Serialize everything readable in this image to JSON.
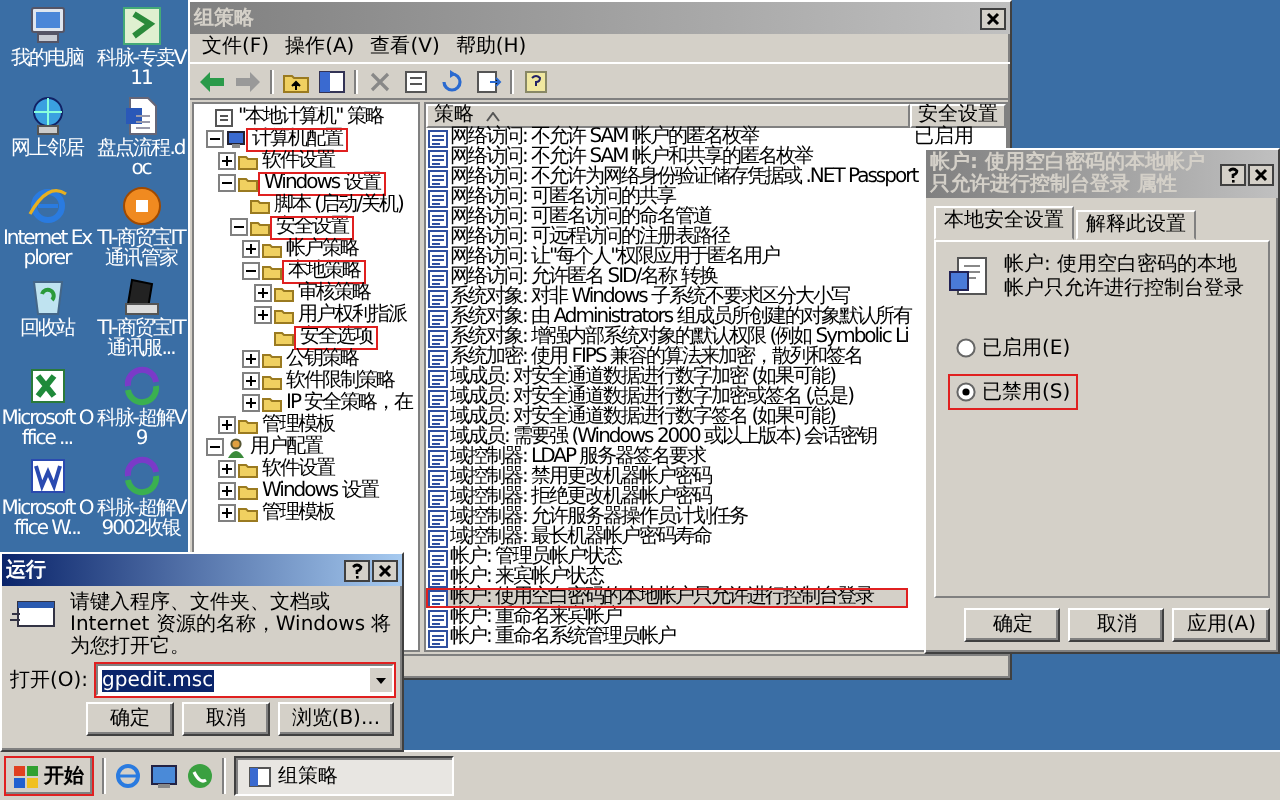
{
  "desktop_icons": [
    {
      "label": "我的电脑"
    },
    {
      "label": "科脉-专卖V11"
    },
    {
      "label": "网上邻居"
    },
    {
      "label": "盘点流程.doc"
    },
    {
      "label": "Internet Explorer"
    },
    {
      "label": "TI-商贸宝IT通讯管家"
    },
    {
      "label": "回收站"
    },
    {
      "label": "TI-商贸宝IT通讯服..."
    },
    {
      "label": "Microsoft Office ..."
    },
    {
      "label": "科脉-超解V9"
    },
    {
      "label": "Microsoft Office W..."
    },
    {
      "label": "科脉-超解V9002收银"
    }
  ],
  "policy_window": {
    "title": "组策略",
    "active": false,
    "menu": [
      "文件(F)",
      "操作(A)",
      "查看(V)",
      "帮助(H)"
    ],
    "tree": [
      {
        "label": "\"本地计算机\" 策略",
        "kind": "none",
        "highlighted": false,
        "children": [
          {
            "label": "计算机配置",
            "kind": "expanded",
            "highlighted": true,
            "children": [
              {
                "label": "软件设置",
                "kind": "collapsed",
                "highlighted": false
              },
              {
                "label": "Windows 设置",
                "kind": "expanded",
                "highlighted": true,
                "children": [
                  {
                    "label": "脚本 (启动/关机)",
                    "kind": "none",
                    "highlighted": false
                  },
                  {
                    "label": "安全设置",
                    "kind": "expanded",
                    "highlighted": true,
                    "children": [
                      {
                        "label": "帐户策略",
                        "kind": "collapsed",
                        "highlighted": false
                      },
                      {
                        "label": "本地策略",
                        "kind": "expanded",
                        "highlighted": true,
                        "children": [
                          {
                            "label": "审核策略",
                            "kind": "collapsed",
                            "highlighted": false
                          },
                          {
                            "label": "用户权利指派",
                            "kind": "collapsed",
                            "highlighted": false
                          },
                          {
                            "label": "安全选项",
                            "kind": "none",
                            "highlighted": true
                          }
                        ]
                      },
                      {
                        "label": "公钥策略",
                        "kind": "collapsed",
                        "highlighted": false
                      },
                      {
                        "label": "软件限制策略",
                        "kind": "collapsed",
                        "highlighted": false
                      },
                      {
                        "label": "IP 安全策略，在",
                        "kind": "collapsed",
                        "highlighted": false
                      }
                    ]
                  }
                ]
              },
              {
                "label": "管理模板",
                "kind": "collapsed",
                "highlighted": false
              }
            ]
          },
          {
            "label": "用户配置",
            "kind": "expanded",
            "highlighted": false,
            "children": [
              {
                "label": "软件设置",
                "kind": "collapsed",
                "highlighted": false
              },
              {
                "label": "Windows 设置",
                "kind": "collapsed",
                "highlighted": false
              },
              {
                "label": "管理模板",
                "kind": "collapsed",
                "highlighted": false
              }
            ]
          }
        ]
      }
    ],
    "list": {
      "columns": [
        "策略",
        "安全设置"
      ],
      "rows": [
        {
          "policy": "网络访问: 不允许 SAM 帐户的匿名枚举",
          "setting": "已启用",
          "selected": false,
          "highlighted": false
        },
        {
          "policy": "网络访问: 不允许 SAM 帐户和共享的匿名枚举",
          "selected": false,
          "highlighted": false
        },
        {
          "policy": "网络访问: 不允许为网络身份验证储存凭据或 .NET Passport",
          "selected": false,
          "highlighted": false
        },
        {
          "policy": "网络访问: 可匿名访问的共享",
          "selected": false,
          "highlighted": false
        },
        {
          "policy": "网络访问: 可匿名访问的命名管道",
          "selected": false,
          "highlighted": false
        },
        {
          "policy": "网络访问: 可远程访问的注册表路径",
          "selected": false,
          "highlighted": false
        },
        {
          "policy": "网络访问: 让\"每个人\"权限应用于匿名用户",
          "selected": false,
          "highlighted": false
        },
        {
          "policy": "网络访问: 允许匿名 SID/名称 转换",
          "selected": false,
          "highlighted": false
        },
        {
          "policy": "系统对象: 对非 Windows 子系统不要求区分大小写",
          "selected": false,
          "highlighted": false
        },
        {
          "policy": "系统对象: 由 Administrators 组成员所创建的对象默认所有",
          "selected": false,
          "highlighted": false
        },
        {
          "policy": "系统对象: 增强内部系统对象的默认权限 (例如 Symbolic Li",
          "selected": false,
          "highlighted": false
        },
        {
          "policy": "系统加密: 使用 FIPS 兼容的算法来加密，散列和签名",
          "selected": false,
          "highlighted": false
        },
        {
          "policy": "域成员: 对安全通道数据进行数字加密 (如果可能)",
          "selected": false,
          "highlighted": false
        },
        {
          "policy": "域成员: 对安全通道数据进行数字加密或签名 (总是)",
          "selected": false,
          "highlighted": false
        },
        {
          "policy": "域成员: 对安全通道数据进行数字签名 (如果可能)",
          "selected": false,
          "highlighted": false
        },
        {
          "policy": "域成员: 需要强 (Windows 2000 或以上版本) 会话密钥",
          "selected": false,
          "highlighted": false
        },
        {
          "policy": "域控制器: LDAP 服务器签名要求",
          "selected": false,
          "highlighted": false
        },
        {
          "policy": "域控制器: 禁用更改机器帐户密码",
          "selected": false,
          "highlighted": false
        },
        {
          "policy": "域控制器: 拒绝更改机器帐户密码",
          "selected": false,
          "highlighted": false
        },
        {
          "policy": "域控制器: 允许服务器操作员计划任务",
          "selected": false,
          "highlighted": false
        },
        {
          "policy": "域控制器: 最长机器帐户密码寿命",
          "selected": false,
          "highlighted": false
        },
        {
          "policy": "帐户: 管理员帐户状态",
          "selected": false,
          "highlighted": false
        },
        {
          "policy": "帐户: 来宾帐户状态",
          "selected": false,
          "highlighted": false
        },
        {
          "policy": "帐户: 使用空白密码的本地帐户只允许进行控制台登录",
          "selected": true,
          "highlighted": true
        },
        {
          "policy": "帐户: 重命名来宾帐户",
          "selected": false,
          "highlighted": false
        },
        {
          "policy": "帐户: 重命名系统管理员帐户",
          "selected": false,
          "highlighted": false
        }
      ]
    }
  },
  "properties_dialog": {
    "title": "帐户: 使用空白密码的本地帐户只允许进行控制台登录 属性",
    "active": false,
    "tabs": [
      {
        "label": "本地安全设置",
        "selected": true
      },
      {
        "label": "解释此设置",
        "selected": false
      }
    ],
    "policy_name": "帐户: 使用空白密码的本地帐户只允许进行控制台登录",
    "options": [
      {
        "label": "已启用(E)",
        "selected": false,
        "highlighted": false
      },
      {
        "label": "已禁用(S)",
        "selected": true,
        "highlighted": true
      }
    ],
    "buttons": [
      "确定",
      "取消",
      "应用(A)"
    ]
  },
  "run_dialog": {
    "title": "运行",
    "active": true,
    "prompt": "请键入程序、文件夹、文档或 Internet 资源的名称，Windows 将为您打开它。",
    "open_label": "打开(O):",
    "value": "gpedit.msc",
    "value_selected": true,
    "highlighted": true,
    "buttons": [
      "确定",
      "取消",
      "浏览(B)..."
    ]
  },
  "taskbar": {
    "start": {
      "label": "开始",
      "highlighted": true
    },
    "tasks": [
      {
        "label": "组策略",
        "selected": true
      }
    ]
  }
}
